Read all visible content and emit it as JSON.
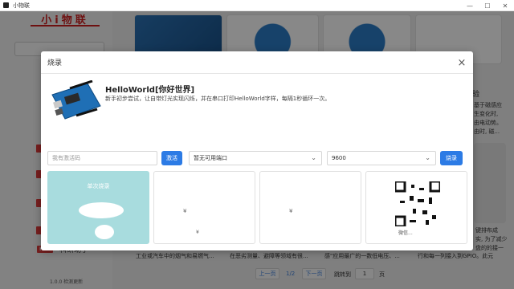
{
  "window": {
    "title": "小物联",
    "minimize": "—",
    "maximize": "☐",
    "close": "✕"
  },
  "sidebar": {
    "logo": "小i物联",
    "hot_badge": "HOT",
    "hot_label": "科研助手",
    "version": "1.0.0 检测更新"
  },
  "background": {
    "card_texts": [
      "工业或汽车中的烟气和易燃气...",
      "在恶劣测量、避障等领域有很...",
      "感\"应用最广的一数低电压、...",
      "行和每一列接入到GPIO。此元"
    ],
    "right_snippets": [
      "验",
      "基于磁感应",
      "生变化时,",
      "由电动势。",
      "由时, 磁...",
      "键排布成",
      "实, 为了减少",
      "盘的的接一"
    ],
    "pager": {
      "prev": "上一页",
      "page": "1/2",
      "next": "下一页",
      "jump_label": "跳转到",
      "jump_value": "1",
      "page_unit": "页"
    }
  },
  "modal": {
    "title": "烧录",
    "close_icon": "×",
    "program": {
      "name": "HelloWorld[你好世界]",
      "description": "新手初步尝试，让自带灯光实现闪烁，并在串口打印HelloWorld字样，每隔1秒循环一次。"
    },
    "activation": {
      "placeholder": "我有激活码",
      "button": "激活"
    },
    "port": {
      "value": "暂无可用端口"
    },
    "baud": {
      "value": "9600"
    },
    "burn_button": "烧录",
    "cards": [
      {
        "title": "单次烧录"
      },
      {
        "price": "¥",
        "label": "¥"
      },
      {
        "price": "¥",
        "label": ""
      },
      {
        "label": "微信..."
      }
    ]
  },
  "colors": {
    "accent": "#2c7be5",
    "brand_red": "#c81e1e",
    "teal_card": "#a8dcde"
  }
}
